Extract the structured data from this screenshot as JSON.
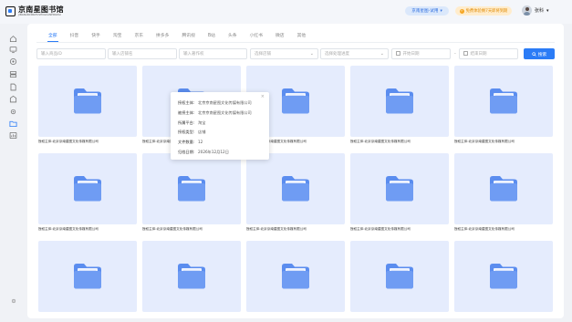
{
  "header": {
    "logo_cn": "京南星图书馆",
    "logo_en": "JINGNANXINGTUSHUGUANPINGTAI",
    "edition_label": "京南星图-试用",
    "edition_chevron": "▾",
    "promo_label": "免费体验剩7天即将到期",
    "promo_icon": "bolt-icon",
    "user_name": "张科",
    "user_chevron": "▾"
  },
  "tabs": [
    {
      "label": "全部",
      "active": true
    },
    {
      "label": "抖音"
    },
    {
      "label": "快手"
    },
    {
      "label": "淘宝"
    },
    {
      "label": "京东"
    },
    {
      "label": "拼多多"
    },
    {
      "label": "腾讯视"
    },
    {
      "label": "B站"
    },
    {
      "label": "头条"
    },
    {
      "label": "小红书"
    },
    {
      "label": "微店"
    },
    {
      "label": "其他"
    }
  ],
  "filters": {
    "input1_placeholder": "输入商品ID",
    "input2_placeholder": "输入店铺名",
    "input3_placeholder": "输入著作权",
    "select1_placeholder": "选择店铺",
    "select2_placeholder": "选择处理进度",
    "date_start_placeholder": "开始日期",
    "date_separator": "-",
    "date_end_placeholder": "结束日期",
    "search_label": "搜索"
  },
  "cards": [
    {
      "caption": "授权主体:北京京南星图文化传媒有限公司"
    },
    {
      "caption": "授权主体:北京京南星图文化传媒有限公司"
    },
    {
      "caption": "授权主体:北京京南星图文化传媒有限公司"
    },
    {
      "caption": "授权主体:北京京南星图文化传媒有限公司"
    },
    {
      "caption": "授权主体:北京京南星图文化传媒有限公司"
    },
    {
      "caption": "授权主体:北京京南星图文化传媒有限公司"
    },
    {
      "caption": "授权主体:北京京南星图文化传媒有限公司"
    },
    {
      "caption": "授权主体:北京京南星图文化传媒有限公司"
    },
    {
      "caption": "授权主体:北京京南星图文化传媒有限公司"
    },
    {
      "caption": "授权主体:北京京南星图文化传媒有限公司"
    },
    {
      "caption": ""
    },
    {
      "caption": ""
    },
    {
      "caption": ""
    },
    {
      "caption": ""
    },
    {
      "caption": ""
    }
  ],
  "popover": {
    "rows": [
      {
        "label": "授权主体:",
        "value": "北京京南星图文化传媒有限公司"
      },
      {
        "label": "被授主体:",
        "value": "北京京南星图文化传媒有限公司"
      },
      {
        "label": "所属平台:",
        "value": "淘宝"
      },
      {
        "label": "授权类型:",
        "value": "店铺"
      },
      {
        "label": "文件数量:",
        "value": "12"
      },
      {
        "label": "归档日期:",
        "value": "2026年12月12日"
      }
    ],
    "close": "×"
  },
  "colors": {
    "accent": "#2b7cf6",
    "folder_bg": "#e5ecfd",
    "promo": "#f5a623"
  }
}
